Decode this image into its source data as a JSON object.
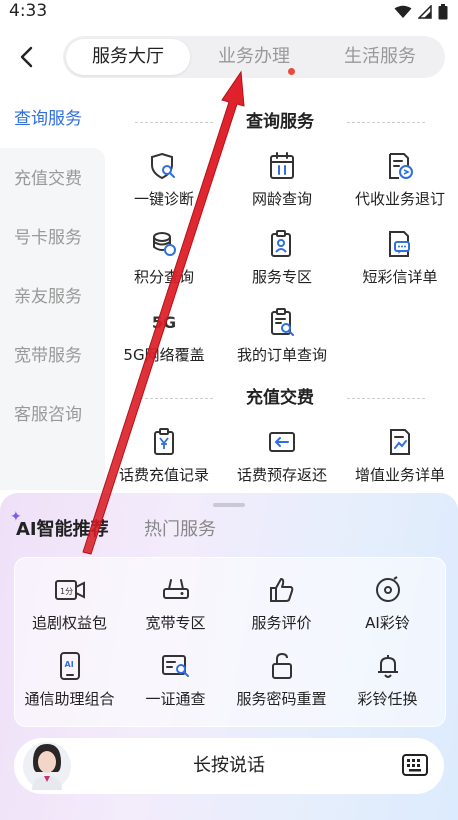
{
  "status_bar": {
    "time": "4:33"
  },
  "header": {
    "tabs": [
      {
        "label": "服务大厅",
        "active": true
      },
      {
        "label": "业务办理",
        "active": false,
        "has_dot": true
      },
      {
        "label": "生活服务",
        "active": false
      }
    ]
  },
  "sidebar": {
    "items": [
      {
        "label": "查询服务",
        "active": true
      },
      {
        "label": "充值交费"
      },
      {
        "label": "号卡服务"
      },
      {
        "label": "亲友服务"
      },
      {
        "label": "宽带服务"
      },
      {
        "label": "客服咨询"
      }
    ]
  },
  "content": {
    "sections": [
      {
        "title": "查询服务",
        "items": [
          {
            "label": "一键诊断",
            "icon": "diagnosis-icon"
          },
          {
            "label": "网龄查询",
            "icon": "calendar-11-icon"
          },
          {
            "label": "代收业务退订",
            "icon": "document-refresh-icon"
          },
          {
            "label": "积分查询",
            "icon": "points-icon"
          },
          {
            "label": "服务专区",
            "icon": "clipboard-user-icon"
          },
          {
            "label": "短彩信详单",
            "icon": "message-list-icon"
          },
          {
            "label": "5G网络覆盖",
            "icon": "5g-icon",
            "badge": "5G"
          },
          {
            "label": "我的订单查询",
            "icon": "order-search-icon"
          }
        ]
      },
      {
        "title": "充值交费",
        "items": [
          {
            "label": "话费充值记录",
            "icon": "yuan-receipt-icon"
          },
          {
            "label": "话费预存返还",
            "icon": "return-card-icon"
          },
          {
            "label": "增值业务详单",
            "icon": "chart-document-icon"
          }
        ]
      }
    ]
  },
  "recommend": {
    "tabs": [
      {
        "label": "AI智能推荐",
        "active": true
      },
      {
        "label": "热门服务"
      }
    ],
    "items": [
      {
        "label": "追剧权益包",
        "icon": "video-camera-icon",
        "badge": "1分"
      },
      {
        "label": "宽带专区",
        "icon": "router-icon"
      },
      {
        "label": "服务评价",
        "icon": "thumbs-up-icon"
      },
      {
        "label": "AI彩铃",
        "icon": "music-disc-icon"
      },
      {
        "label": "通信助理组合",
        "icon": "ai-phone-icon",
        "badge": "AI"
      },
      {
        "label": "一证通查",
        "icon": "id-search-icon"
      },
      {
        "label": "服务密码重置",
        "icon": "unlock-icon"
      },
      {
        "label": "彩铃任换",
        "icon": "bell-icon"
      }
    ]
  },
  "voice_bar": {
    "label": "长按说话"
  },
  "colors": {
    "accent": "#2f6fe0",
    "icon_stroke": "#333333",
    "dot": "#e94a3d",
    "annotation_arrow": "#e0202a"
  }
}
